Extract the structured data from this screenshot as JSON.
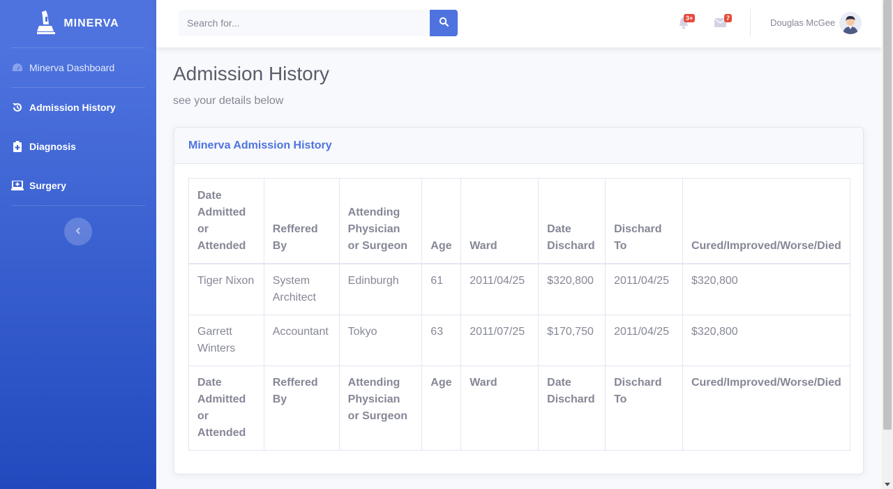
{
  "sidebar": {
    "brand": "MINERVA",
    "dashboard_label": "Minerva Dashboard",
    "items": [
      {
        "label": "Admission History",
        "icon": "history-icon"
      },
      {
        "label": "Diagnosis",
        "icon": "clipboard-icon"
      },
      {
        "label": "Surgery",
        "icon": "laptop-medical-icon"
      }
    ]
  },
  "topbar": {
    "search_placeholder": "Search for...",
    "alerts_badge": "3+",
    "messages_badge": "7",
    "user_name": "Douglas McGee"
  },
  "page": {
    "title": "Admission History",
    "subtitle": "see your details below"
  },
  "card": {
    "title": "Minerva Admission History"
  },
  "table": {
    "headers": [
      "Date Admitted or Attended",
      "Reffered By",
      "Attending Physician or Surgeon",
      "Age",
      "Ward",
      "Date Dischard",
      "Dischard To",
      "Cured/Improved/Worse/Died"
    ],
    "rows": [
      [
        "Tiger Nixon",
        "System Architect",
        "Edinburgh",
        "61",
        "2011/04/25",
        "$320,800",
        "2011/04/25",
        "$320,800"
      ],
      [
        "Garrett Winters",
        "Accountant",
        "Tokyo",
        "63",
        "2011/07/25",
        "$170,750",
        "2011/04/25",
        "$320,800"
      ]
    ]
  },
  "colors": {
    "primary": "#4e73df",
    "sidebar_gradient_end": "#224abe",
    "badge": "#e74a3b",
    "text": "#858796"
  }
}
